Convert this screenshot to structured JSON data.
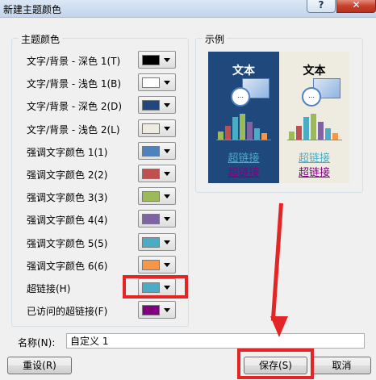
{
  "window": {
    "title": "新建主题颜色",
    "help_label": "?",
    "close_label": "✕"
  },
  "theme_colors": {
    "group_label": "主题颜色",
    "items": [
      {
        "label": "文字/背景 - 深色 1(T)",
        "color": "#000000"
      },
      {
        "label": "文字/背景 - 浅色 1(B)",
        "color": "#ffffff"
      },
      {
        "label": "文字/背景 - 深色 2(D)",
        "color": "#1f497d"
      },
      {
        "label": "文字/背景 - 浅色 2(L)",
        "color": "#eeece1"
      },
      {
        "label": "强调文字颜色 1(1)",
        "color": "#4f81bd"
      },
      {
        "label": "强调文字颜色 2(2)",
        "color": "#c0504d"
      },
      {
        "label": "强调文字颜色 3(3)",
        "color": "#9bbb59"
      },
      {
        "label": "强调文字颜色 4(4)",
        "color": "#8064a2"
      },
      {
        "label": "强调文字颜色 5(5)",
        "color": "#4bacc6"
      },
      {
        "label": "强调文字颜色 6(6)",
        "color": "#f79646"
      },
      {
        "label": "超链接(H)",
        "color": "#4bacc6"
      },
      {
        "label": "已访问的超链接(F)",
        "color": "#800080"
      }
    ]
  },
  "sample": {
    "group_label": "示例",
    "dark_title": "文本",
    "light_title": "文本",
    "link_text": "超链接",
    "visited_link_text": "超链接",
    "link_color": "#4bacc6",
    "visited_link_color": "#800080"
  },
  "name_field": {
    "label": "名称(N):",
    "value": "自定义 1"
  },
  "buttons": {
    "reset": "重设(R)",
    "save": "保存(S)",
    "cancel": "取消"
  },
  "annotation_color": "#e42525"
}
